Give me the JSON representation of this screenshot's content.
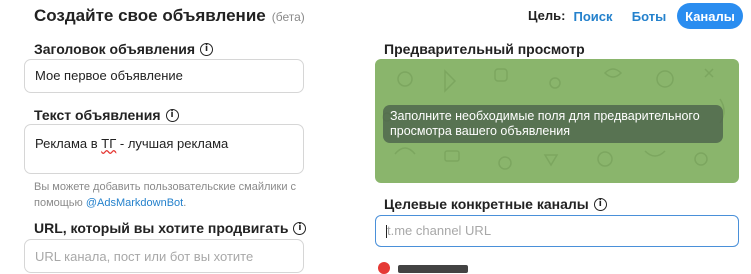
{
  "header": {
    "title": "Создайте свое объявление",
    "beta": "(бета)"
  },
  "goal": {
    "label": "Цель:",
    "tabs": [
      {
        "label": "Поиск",
        "active": false
      },
      {
        "label": "Боты",
        "active": false
      },
      {
        "label": "Каналы",
        "active": true
      }
    ]
  },
  "form": {
    "title_label": "Заголовок объявления",
    "title_value": "Мое первое объявление",
    "text_label": "Текст объявления",
    "text_value_before": "Реклама в ",
    "text_value_misspelled": "ТГ",
    "text_value_after": " - лучшая реклама",
    "hint_text": "Вы можете добавить пользовательские смайлики с помощью ",
    "hint_link": "@AdsMarkdownBot",
    "hint_end": ".",
    "url_label": "URL, который вы хотите продвигать",
    "url_placeholder": "URL канала, пост или бот вы хотите"
  },
  "preview": {
    "label": "Предварительный просмотр",
    "message": "Заполните необходимые поля для предварительного просмотра вашего объявления",
    "background_color": "#8ab56c"
  },
  "channels": {
    "label": "Целевые конкретные каналы",
    "placeholder": "t.me channel URL"
  },
  "accent_color": "#2a8df0"
}
